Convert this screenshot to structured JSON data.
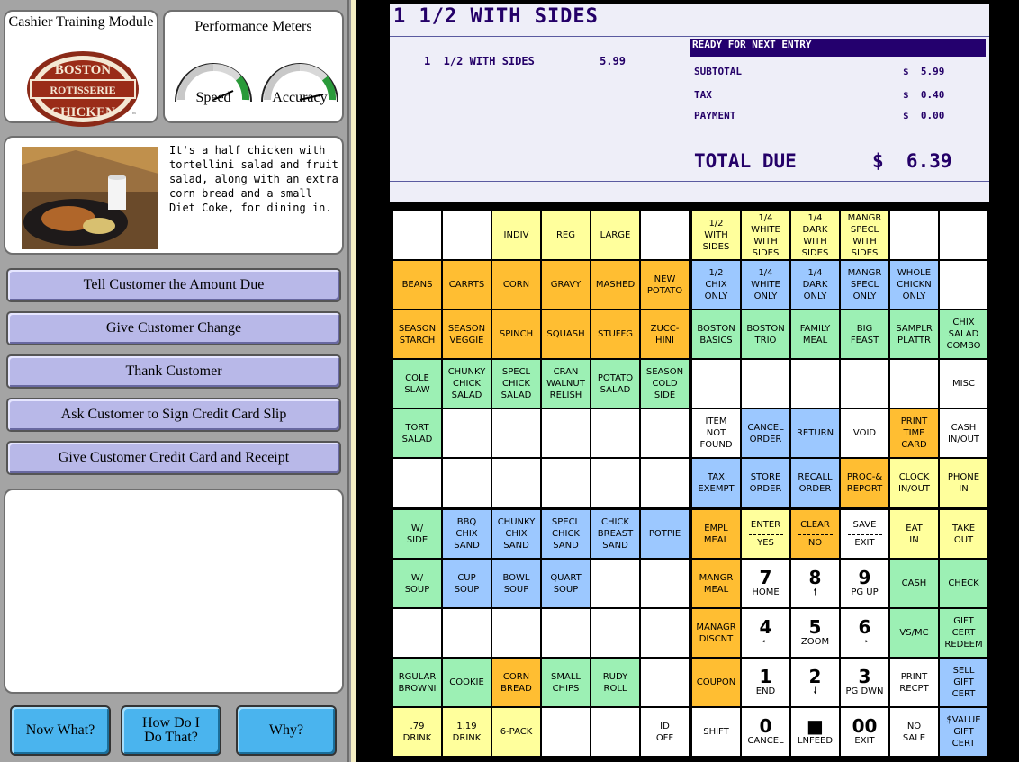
{
  "left": {
    "title": "Cashier Training Module",
    "logo": {
      "top": "BOSTON",
      "mid": "ROTISSERIE",
      "bottom": "CHICKEN",
      "tm": "™"
    },
    "meters": {
      "title": "Performance Meters",
      "speed": "Speed",
      "accuracy": "Accuracy"
    },
    "description": "It's a half chicken with tortellini salad and fruit salad, along with an extra corn bread and a small Diet Coke, for dining in.",
    "tasks": [
      "Tell Customer the Amount Due",
      "Give Customer Change",
      "Thank Customer",
      "Ask Customer to Sign Credit Card Slip",
      "Give Customer Credit Card and Receipt"
    ],
    "help": [
      "Now What?",
      "How Do I Do That?",
      "Why?"
    ]
  },
  "receipt": {
    "title": "1  1/2 WITH SIDES",
    "line": "1  1/2 WITH SIDES          5.99",
    "status": "READY FOR NEXT ENTRY",
    "subtotal_label": "SUBTOTAL",
    "subtotal": "$  5.99",
    "tax_label": "TAX",
    "tax": "$  0.40",
    "payment_label": "PAYMENT",
    "payment": "$  0.00",
    "total_label": "TOTAL DUE",
    "total": "$  6.39"
  },
  "colors": {
    "yellow": "#ffff9c",
    "orange": "#ffbe32",
    "green": "#9cf0b4",
    "blue": "#9cc8ff",
    "white": "#ffffff"
  },
  "keys": [
    {
      "id": "blank-0-0",
      "c": "w",
      "t": ""
    },
    {
      "id": "blank-0-1",
      "c": "w",
      "t": ""
    },
    {
      "id": "indiv",
      "c": "y",
      "t": "INDIV"
    },
    {
      "id": "reg",
      "c": "y",
      "t": "REG"
    },
    {
      "id": "large",
      "c": "y",
      "t": "LARGE"
    },
    {
      "id": "blank-0-5",
      "c": "w",
      "t": ""
    },
    {
      "id": "half-with-sides",
      "c": "y",
      "t": "1/2\nWITH\nSIDES"
    },
    {
      "id": "quarter-white-with-sides",
      "c": "y",
      "t": "1/4\nWHITE\nWITH\nSIDES"
    },
    {
      "id": "quarter-dark-with-sides",
      "c": "y",
      "t": "1/4\nDARK\nWITH\nSIDES"
    },
    {
      "id": "mangr-specl-with-sides",
      "c": "y",
      "t": "MANGR\nSPECL\nWITH\nSIDES"
    },
    {
      "id": "blank-0-10",
      "c": "w",
      "t": ""
    },
    {
      "id": "blank-0-11",
      "c": "w",
      "t": ""
    },
    {
      "id": "beans",
      "c": "o",
      "t": "BEANS"
    },
    {
      "id": "carrts",
      "c": "o",
      "t": "CARRTS"
    },
    {
      "id": "corn",
      "c": "o",
      "t": "CORN"
    },
    {
      "id": "gravy",
      "c": "o",
      "t": "GRAVY"
    },
    {
      "id": "mashed",
      "c": "o",
      "t": "MASHED"
    },
    {
      "id": "new-potato",
      "c": "o",
      "t": "NEW\nPOTATO"
    },
    {
      "id": "half-chix-only",
      "c": "b",
      "t": "1/2\nCHIX\nONLY"
    },
    {
      "id": "quarter-white-only",
      "c": "b",
      "t": "1/4\nWHITE\nONLY"
    },
    {
      "id": "quarter-dark-only",
      "c": "b",
      "t": "1/4\nDARK\nONLY"
    },
    {
      "id": "mangr-specl-only",
      "c": "b",
      "t": "MANGR\nSPECL\nONLY"
    },
    {
      "id": "whole-chickn-only",
      "c": "b",
      "t": "WHOLE\nCHICKN\nONLY"
    },
    {
      "id": "blank-1-11",
      "c": "w",
      "t": ""
    },
    {
      "id": "season-starch",
      "c": "o",
      "t": "SEASON\nSTARCH"
    },
    {
      "id": "season-veggie",
      "c": "o",
      "t": "SEASON\nVEGGIE"
    },
    {
      "id": "spinch",
      "c": "o",
      "t": "SPINCH"
    },
    {
      "id": "squash",
      "c": "o",
      "t": "SQUASH"
    },
    {
      "id": "stuffg",
      "c": "o",
      "t": "STUFFG"
    },
    {
      "id": "zucchini",
      "c": "o",
      "t": "ZUCC-\nHINI"
    },
    {
      "id": "boston-basics",
      "c": "g",
      "t": "BOSTON\nBASICS"
    },
    {
      "id": "boston-trio",
      "c": "g",
      "t": "BOSTON\nTRIO"
    },
    {
      "id": "family-meal",
      "c": "g",
      "t": "FAMILY\nMEAL"
    },
    {
      "id": "big-feast",
      "c": "g",
      "t": "BIG\nFEAST"
    },
    {
      "id": "samplr-plattr",
      "c": "g",
      "t": "SAMPLR\nPLATTR"
    },
    {
      "id": "chix-salad-combo",
      "c": "g",
      "t": "CHIX\nSALAD\nCOMBO"
    },
    {
      "id": "cole-slaw",
      "c": "g",
      "t": "COLE\nSLAW"
    },
    {
      "id": "chunky-chick-salad",
      "c": "g",
      "t": "CHUNKY\nCHICK\nSALAD"
    },
    {
      "id": "specl-chick-salad",
      "c": "g",
      "t": "SPECL\nCHICK\nSALAD"
    },
    {
      "id": "cran-walnut-relish",
      "c": "g",
      "t": "CRAN\nWALNUT\nRELISH"
    },
    {
      "id": "potato-salad",
      "c": "g",
      "t": "POTATO\nSALAD"
    },
    {
      "id": "season-cold-side",
      "c": "g",
      "t": "SEASON\nCOLD\nSIDE"
    },
    {
      "id": "blank-3-6",
      "c": "w",
      "t": ""
    },
    {
      "id": "blank-3-7",
      "c": "w",
      "t": ""
    },
    {
      "id": "blank-3-8",
      "c": "w",
      "t": ""
    },
    {
      "id": "blank-3-9",
      "c": "w",
      "t": ""
    },
    {
      "id": "blank-3-10",
      "c": "w",
      "t": ""
    },
    {
      "id": "misc",
      "c": "w",
      "t": "MISC"
    },
    {
      "id": "tort-salad",
      "c": "g",
      "t": "TORT\nSALAD"
    },
    {
      "id": "blank-4-1",
      "c": "w",
      "t": ""
    },
    {
      "id": "blank-4-2",
      "c": "w",
      "t": ""
    },
    {
      "id": "blank-4-3",
      "c": "w",
      "t": ""
    },
    {
      "id": "blank-4-4",
      "c": "w",
      "t": ""
    },
    {
      "id": "blank-4-5",
      "c": "w",
      "t": ""
    },
    {
      "id": "item-not-found",
      "c": "w",
      "t": "ITEM\nNOT\nFOUND"
    },
    {
      "id": "cancel-order",
      "c": "b",
      "t": "CANCEL\nORDER"
    },
    {
      "id": "return",
      "c": "b",
      "t": "RETURN"
    },
    {
      "id": "void",
      "c": "w",
      "t": "VOID"
    },
    {
      "id": "print-time-card",
      "c": "o",
      "t": "PRINT\nTIME\nCARD"
    },
    {
      "id": "cash-in-out",
      "c": "w",
      "t": "CASH\nIN/OUT"
    },
    {
      "id": "blank-5-0",
      "c": "w",
      "t": ""
    },
    {
      "id": "blank-5-1",
      "c": "w",
      "t": ""
    },
    {
      "id": "blank-5-2",
      "c": "w",
      "t": ""
    },
    {
      "id": "blank-5-3",
      "c": "w",
      "t": ""
    },
    {
      "id": "blank-5-4",
      "c": "w",
      "t": ""
    },
    {
      "id": "blank-5-5",
      "c": "w",
      "t": ""
    },
    {
      "id": "tax-exempt",
      "c": "b",
      "t": "TAX\nEXEMPT"
    },
    {
      "id": "store-order",
      "c": "b",
      "t": "STORE\nORDER"
    },
    {
      "id": "recall-order",
      "c": "b",
      "t": "RECALL\nORDER"
    },
    {
      "id": "proc-report",
      "c": "o",
      "t": "PROC-&\nREPORT"
    },
    {
      "id": "clock-in-out",
      "c": "y",
      "t": "CLOCK\nIN/OUT"
    },
    {
      "id": "phone-in",
      "c": "y",
      "t": "PHONE\nIN"
    },
    {
      "id": "w-side",
      "c": "g",
      "t": "W/\nSIDE"
    },
    {
      "id": "bbq-chix-sand",
      "c": "b",
      "t": "BBQ\nCHIX\nSAND"
    },
    {
      "id": "chunky-chix-sand",
      "c": "b",
      "t": "CHUNKY\nCHIX\nSAND"
    },
    {
      "id": "specl-chick-sand",
      "c": "b",
      "t": "SPECL\nCHICK\nSAND"
    },
    {
      "id": "chick-breast-sand",
      "c": "b",
      "t": "CHICK\nBREAST\nSAND"
    },
    {
      "id": "potpie",
      "c": "b",
      "t": "POTPIE"
    },
    {
      "id": "empl-meal",
      "c": "o",
      "t": "EMPL\nMEAL"
    },
    {
      "id": "enter-yes",
      "c": "y",
      "k": "split",
      "t": "ENTER",
      "t2": "YES"
    },
    {
      "id": "clear-no",
      "c": "o",
      "k": "split",
      "t": "CLEAR",
      "t2": "NO"
    },
    {
      "id": "save-exit",
      "c": "w",
      "k": "split",
      "t": "SAVE",
      "t2": "EXIT"
    },
    {
      "id": "eat-in",
      "c": "y",
      "t": "EAT\nIN"
    },
    {
      "id": "take-out",
      "c": "y",
      "t": "TAKE\nOUT"
    },
    {
      "id": "w-soup",
      "c": "g",
      "t": "W/\nSOUP"
    },
    {
      "id": "cup-soup",
      "c": "b",
      "t": "CUP\nSOUP"
    },
    {
      "id": "bowl-soup",
      "c": "b",
      "t": "BOWL\nSOUP"
    },
    {
      "id": "quart-soup",
      "c": "b",
      "t": "QUART\nSOUP"
    },
    {
      "id": "blank-7-4",
      "c": "w",
      "t": ""
    },
    {
      "id": "blank-7-5",
      "c": "w",
      "t": ""
    },
    {
      "id": "mangr-meal",
      "c": "o",
      "t": "MANGR\nMEAL"
    },
    {
      "id": "key-7",
      "c": "w",
      "k": "num",
      "t": "7",
      "t2": "HOME"
    },
    {
      "id": "key-8",
      "c": "w",
      "k": "num",
      "t": "8",
      "t2": "🠕"
    },
    {
      "id": "key-9",
      "c": "w",
      "k": "num",
      "t": "9",
      "t2": "PG UP"
    },
    {
      "id": "cash",
      "c": "g",
      "t": "CASH"
    },
    {
      "id": "check",
      "c": "g",
      "t": "CHECK"
    },
    {
      "id": "blank-8-0",
      "c": "w",
      "t": ""
    },
    {
      "id": "blank-8-1",
      "c": "w",
      "t": ""
    },
    {
      "id": "blank-8-2",
      "c": "w",
      "t": ""
    },
    {
      "id": "blank-8-3",
      "c": "w",
      "t": ""
    },
    {
      "id": "blank-8-4",
      "c": "w",
      "t": ""
    },
    {
      "id": "blank-8-5",
      "c": "w",
      "t": ""
    },
    {
      "id": "managr-discnt",
      "c": "o",
      "t": "MANAGR\nDISCNT"
    },
    {
      "id": "key-4",
      "c": "w",
      "k": "num",
      "t": "4",
      "t2": "🠔"
    },
    {
      "id": "key-5",
      "c": "w",
      "k": "num",
      "t": "5",
      "t2": "ZOOM"
    },
    {
      "id": "key-6",
      "c": "w",
      "k": "num",
      "t": "6",
      "t2": "🠖"
    },
    {
      "id": "vs-mc",
      "c": "g",
      "t": "VS/MC"
    },
    {
      "id": "gift-cert-redeem",
      "c": "g",
      "t": "GIFT\nCERT\nREDEEM"
    },
    {
      "id": "rgular-browni",
      "c": "g",
      "t": "RGULAR\nBROWNI"
    },
    {
      "id": "cookie",
      "c": "g",
      "t": "COOKIE"
    },
    {
      "id": "corn-bread",
      "c": "o",
      "t": "CORN\nBREAD"
    },
    {
      "id": "small-chips",
      "c": "g",
      "t": "SMALL\nCHIPS"
    },
    {
      "id": "rudy-roll",
      "c": "g",
      "t": "RUDY\nROLL"
    },
    {
      "id": "blank-9-5",
      "c": "w",
      "t": ""
    },
    {
      "id": "coupon",
      "c": "o",
      "t": "COUPON"
    },
    {
      "id": "key-1",
      "c": "w",
      "k": "num",
      "t": "1",
      "t2": "END"
    },
    {
      "id": "key-2",
      "c": "w",
      "k": "num",
      "t": "2",
      "t2": "🠗"
    },
    {
      "id": "key-3",
      "c": "w",
      "k": "num",
      "t": "3",
      "t2": "PG DWN"
    },
    {
      "id": "print-recpt",
      "c": "w",
      "t": "PRINT\nRECPT"
    },
    {
      "id": "sell-gift-cert",
      "c": "b",
      "t": "SELL\nGIFT\nCERT"
    },
    {
      "id": "drink-79",
      "c": "y",
      "t": ".79\nDRINK"
    },
    {
      "id": "drink-119",
      "c": "y",
      "t": "1.19\nDRINK"
    },
    {
      "id": "six-pack",
      "c": "y",
      "t": "6-PACK"
    },
    {
      "id": "blank-10-3",
      "c": "w",
      "t": ""
    },
    {
      "id": "blank-10-4",
      "c": "w",
      "t": ""
    },
    {
      "id": "id-off",
      "c": "w",
      "t": "ID\nOFF"
    },
    {
      "id": "shift",
      "c": "w",
      "t": "SHIFT"
    },
    {
      "id": "key-0",
      "c": "w",
      "k": "num",
      "t": "0",
      "t2": "CANCEL"
    },
    {
      "id": "key-dot",
      "c": "w",
      "k": "num",
      "t": "■",
      "t2": "LNFEED"
    },
    {
      "id": "key-00",
      "c": "w",
      "k": "num",
      "t": "00",
      "t2": "EXIT"
    },
    {
      "id": "no-sale",
      "c": "w",
      "t": "NO\nSALE"
    },
    {
      "id": "value-gift-cert",
      "c": "b",
      "t": "$VALUE\nGIFT\nCERT"
    }
  ]
}
